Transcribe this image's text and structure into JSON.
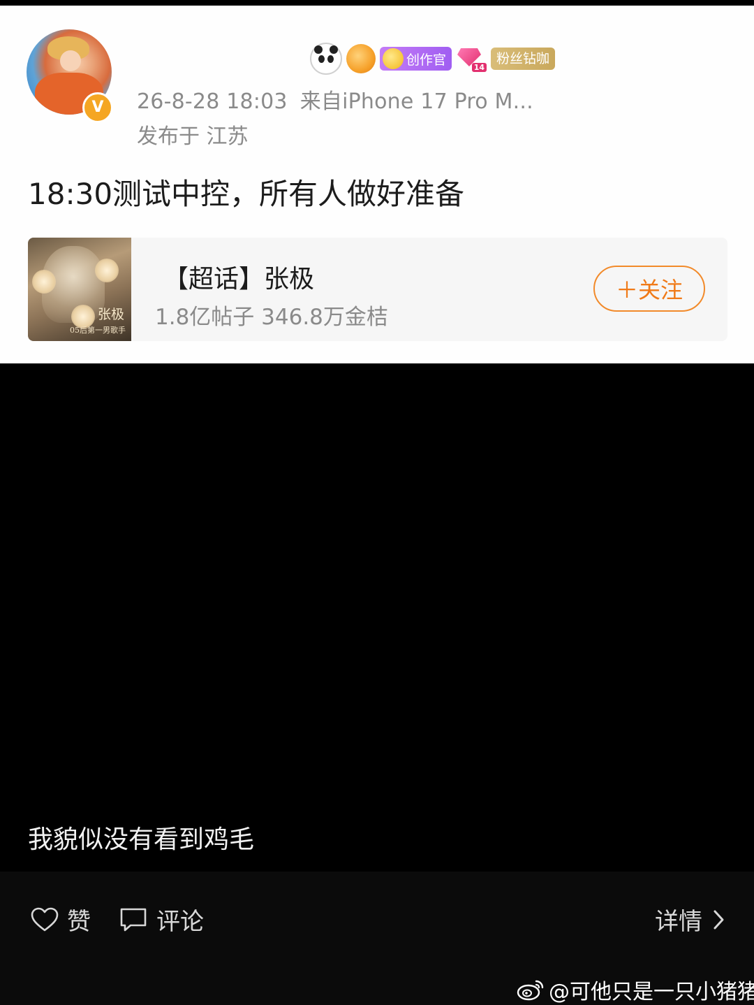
{
  "post": {
    "badges": {
      "creator_label": "创作官",
      "diamond_level": "14",
      "fans_label": "粉丝钻咖"
    },
    "timestamp": "26-8-28 18:03",
    "source": "来自iPhone 17 Pro M...",
    "location": "发布于 江苏",
    "text": "18:30测试中控，所有人做好准备",
    "topic": {
      "title": "【超话】张极",
      "stats": "1.8亿帖子 346.8万金桔",
      "follow_label": "＋关注",
      "thumb_name": "张极",
      "thumb_sub": "05后第一男歌手"
    }
  },
  "caption": "我貌似没有看到鸡毛",
  "actions": {
    "like_label": "赞",
    "comment_label": "评论",
    "detail_label": "详情"
  },
  "watermark": "@可他只是一只小猪猪",
  "colors": {
    "accent_orange": "#f07a18",
    "verified_badge": "#f5a623",
    "creator_badge": "#a05ef2",
    "fans_badge": "#c9a85c"
  },
  "icons": [
    "avatar",
    "verified-icon",
    "panda-icon",
    "fish-icon",
    "creator-icon",
    "diamond-icon",
    "heart-icon",
    "comment-icon",
    "chevron-right-icon",
    "weibo-icon"
  ]
}
